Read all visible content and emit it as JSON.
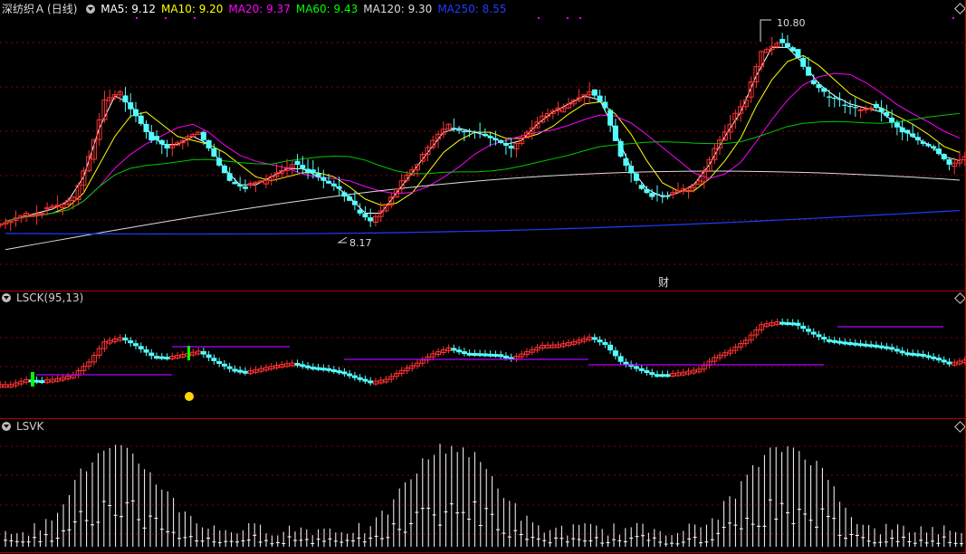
{
  "stock": {
    "name": "深纺织Ａ",
    "period": "(日线)"
  },
  "ma_legend": [
    {
      "label": "MA5: 9.12",
      "color": "#ffffff"
    },
    {
      "label": "MA10: 9.20",
      "color": "#ffff00"
    },
    {
      "label": "MA20: 9.37",
      "color": "#ff00ff"
    },
    {
      "label": "MA60: 9.43",
      "color": "#00ff00"
    },
    {
      "label": "MA120: 9.30",
      "color": "#dcdcdc"
    },
    {
      "label": "MA250: 8.55",
      "color": "#1e3cff"
    }
  ],
  "high_label": "10.80",
  "low_label": "8.17",
  "event_marker": "财",
  "lsck": {
    "title": "LSCK(95,13)"
  },
  "lsvk": {
    "title": "LSVK"
  },
  "colors": {
    "up": "#ff3232",
    "down": "#54ffff",
    "ma5": "#ffffff",
    "ma10": "#ffff00",
    "ma20": "#ff00ff",
    "ma60": "#00c800",
    "ma120": "#dcdcdc",
    "ma250": "#1e3cff",
    "border": "#b40000",
    "grid": "#8b0000",
    "lsvk_bar": "#ffffff",
    "lsck_hl": "#b400ff",
    "lsck_green": "#00ff00",
    "dot": "#ffd700"
  },
  "chart_data": [
    {
      "type": "candlestick",
      "title": "深纺织Ａ (日线)",
      "ohlc_price_range": [
        8.17,
        10.8
      ],
      "annotations": [
        {
          "label": "10.80",
          "kind": "high"
        },
        {
          "label": "8.17",
          "kind": "low"
        }
      ],
      "series": [
        {
          "name": "MA5",
          "last": 9.12
        },
        {
          "name": "MA10",
          "last": 9.2
        },
        {
          "name": "MA20",
          "last": 9.37
        },
        {
          "name": "MA60",
          "last": 9.43
        },
        {
          "name": "MA120",
          "last": 9.3
        },
        {
          "name": "MA250",
          "last": 8.55
        }
      ],
      "closes": [
        8.4,
        8.5,
        8.5,
        8.6,
        8.7,
        9.2,
        9.9,
        10.0,
        9.7,
        9.4,
        9.3,
        9.4,
        9.5,
        9.2,
        8.9,
        8.8,
        8.9,
        9.0,
        9.1,
        9.0,
        8.9,
        8.8,
        8.6,
        8.4,
        8.6,
        8.9,
        9.1,
        9.4,
        9.6,
        9.5,
        9.5,
        9.4,
        9.3,
        9.5,
        9.7,
        9.8,
        9.9,
        10.0,
        9.8,
        9.2,
        8.9,
        8.7,
        8.7,
        8.8,
        8.9,
        9.3,
        9.6,
        9.9,
        10.5,
        10.6,
        10.5,
        10.2,
        10.0,
        9.9,
        9.8,
        9.8,
        9.7,
        9.5,
        9.4,
        9.3,
        9.1,
        9.2
      ]
    },
    {
      "type": "candlestick",
      "title": "LSCK(95,13)"
    },
    {
      "type": "bar",
      "title": "LSVK"
    }
  ]
}
